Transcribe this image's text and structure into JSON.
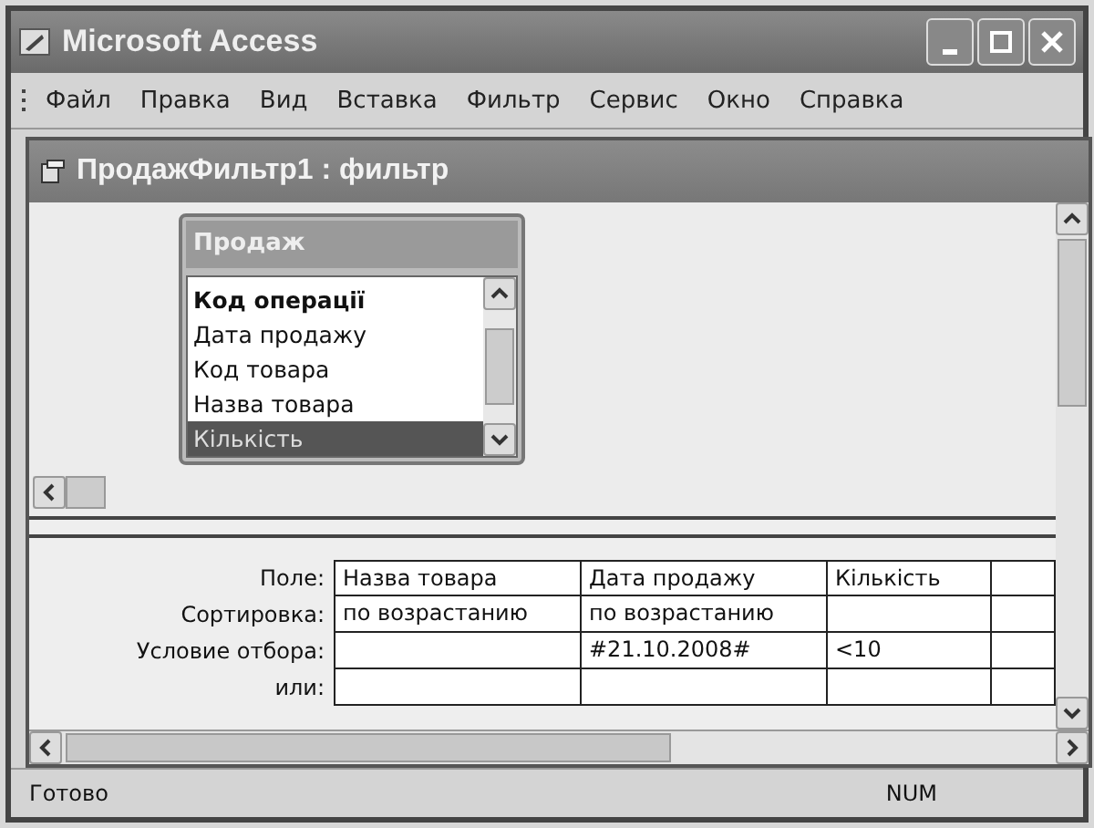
{
  "window": {
    "title": "Microsoft Access"
  },
  "menu": [
    "Файл",
    "Правка",
    "Вид",
    "Вставка",
    "Фильтр",
    "Сервис",
    "Окно",
    "Справка"
  ],
  "child_window": {
    "title": "ПродажФильтр1 : фильтр"
  },
  "table_box": {
    "title": "Продаж",
    "fields": [
      {
        "name": "Код операції",
        "primary_key": true,
        "selected": false
      },
      {
        "name": "Дата продажу",
        "primary_key": false,
        "selected": false
      },
      {
        "name": "Код товара",
        "primary_key": false,
        "selected": false
      },
      {
        "name": "Назва товара",
        "primary_key": false,
        "selected": false
      },
      {
        "name": "Кількість",
        "primary_key": false,
        "selected": true
      }
    ]
  },
  "grid": {
    "rows": [
      {
        "label": "Поле:",
        "cells": [
          "Назва товара",
          "Дата продажу",
          "Кількість"
        ]
      },
      {
        "label": "Сортировка:",
        "cells": [
          "по возрастанию",
          "по возрастанию",
          ""
        ]
      },
      {
        "label": "Условие отбора:",
        "cells": [
          "",
          "#21.10.2008#",
          "<10"
        ]
      },
      {
        "label": "или:",
        "cells": [
          "",
          "",
          ""
        ]
      }
    ]
  },
  "status_bar": {
    "text": "Готово",
    "indicator": "NUM"
  }
}
